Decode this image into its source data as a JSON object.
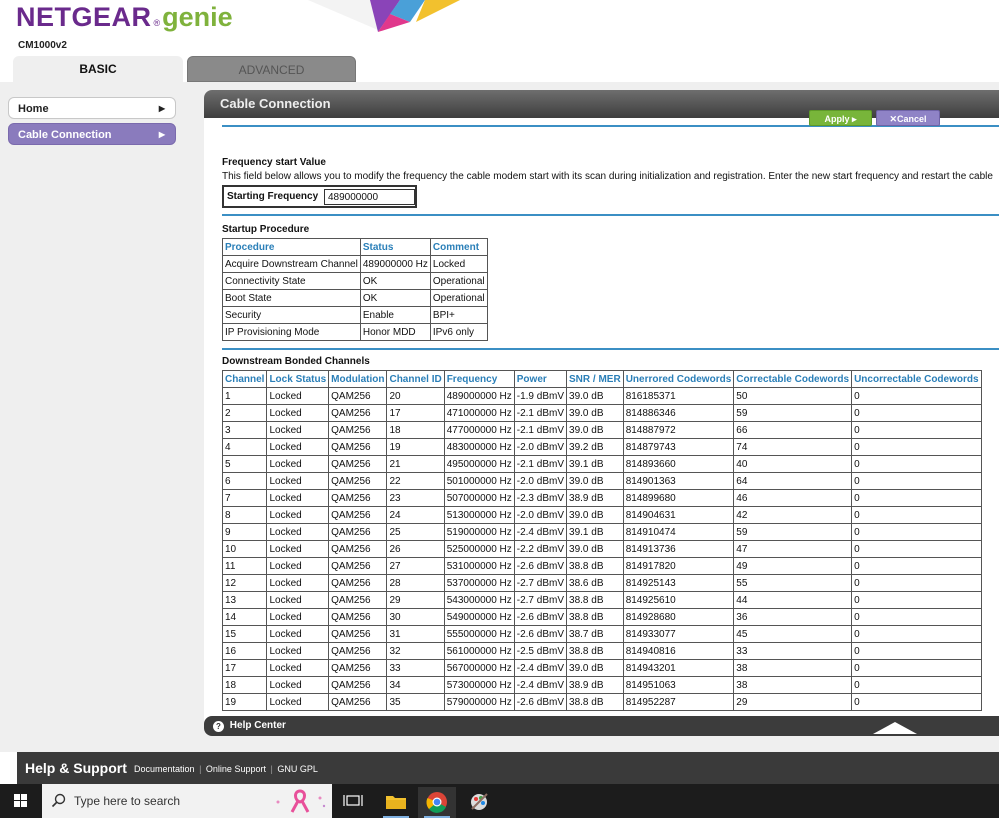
{
  "brand": {
    "name": "NETGEAR",
    "reg": "®",
    "product": "genie",
    "model": "CM1000v2"
  },
  "tabs": {
    "basic": "BASIC",
    "advanced": "ADVANCED"
  },
  "nav": {
    "home": "Home",
    "cable": "Cable Connection"
  },
  "panel_title": "Cable Connection",
  "buttons": {
    "apply": "Apply ▸",
    "cancel": "✕Cancel"
  },
  "freq": {
    "title": "Frequency start Value",
    "desc": "This field below allows you to modify the frequency the cable modem start with its scan during initialization and registration. Enter the new start frequency and restart the cable",
    "label": "Starting Frequency",
    "value": "489000000"
  },
  "startup": {
    "title": "Startup Procedure",
    "headers": [
      "Procedure",
      "Status",
      "Comment"
    ],
    "rows": [
      [
        "Acquire Downstream Channel",
        "489000000 Hz",
        "Locked"
      ],
      [
        "Connectivity State",
        "OK",
        "Operational"
      ],
      [
        "Boot State",
        "OK",
        "Operational"
      ],
      [
        "Security",
        "Enable",
        "BPI+"
      ],
      [
        "IP Provisioning Mode",
        "Honor MDD",
        "IPv6 only"
      ]
    ]
  },
  "downstream": {
    "title": "Downstream Bonded Channels",
    "headers": [
      "Channel",
      "Lock Status",
      "Modulation",
      "Channel ID",
      "Frequency",
      "Power",
      "SNR / MER",
      "Unerrored Codewords",
      "Correctable Codewords",
      "Uncorrectable Codewords"
    ],
    "rows": [
      [
        "1",
        "Locked",
        "QAM256",
        "20",
        "489000000 Hz",
        "-1.9 dBmV",
        "39.0 dB",
        "816185371",
        "50",
        "0"
      ],
      [
        "2",
        "Locked",
        "QAM256",
        "17",
        "471000000 Hz",
        "-2.1 dBmV",
        "39.0 dB",
        "814886346",
        "59",
        "0"
      ],
      [
        "3",
        "Locked",
        "QAM256",
        "18",
        "477000000 Hz",
        "-2.1 dBmV",
        "39.0 dB",
        "814887972",
        "66",
        "0"
      ],
      [
        "4",
        "Locked",
        "QAM256",
        "19",
        "483000000 Hz",
        "-2.0 dBmV",
        "39.2 dB",
        "814879743",
        "74",
        "0"
      ],
      [
        "5",
        "Locked",
        "QAM256",
        "21",
        "495000000 Hz",
        "-2.1 dBmV",
        "39.1 dB",
        "814893660",
        "40",
        "0"
      ],
      [
        "6",
        "Locked",
        "QAM256",
        "22",
        "501000000 Hz",
        "-2.0 dBmV",
        "39.0 dB",
        "814901363",
        "64",
        "0"
      ],
      [
        "7",
        "Locked",
        "QAM256",
        "23",
        "507000000 Hz",
        "-2.3 dBmV",
        "38.9 dB",
        "814899680",
        "46",
        "0"
      ],
      [
        "8",
        "Locked",
        "QAM256",
        "24",
        "513000000 Hz",
        "-2.0 dBmV",
        "39.0 dB",
        "814904631",
        "42",
        "0"
      ],
      [
        "9",
        "Locked",
        "QAM256",
        "25",
        "519000000 Hz",
        "-2.4 dBmV",
        "39.1 dB",
        "814910474",
        "59",
        "0"
      ],
      [
        "10",
        "Locked",
        "QAM256",
        "26",
        "525000000 Hz",
        "-2.2 dBmV",
        "39.0 dB",
        "814913736",
        "47",
        "0"
      ],
      [
        "11",
        "Locked",
        "QAM256",
        "27",
        "531000000 Hz",
        "-2.6 dBmV",
        "38.8 dB",
        "814917820",
        "49",
        "0"
      ],
      [
        "12",
        "Locked",
        "QAM256",
        "28",
        "537000000 Hz",
        "-2.7 dBmV",
        "38.6 dB",
        "814925143",
        "55",
        "0"
      ],
      [
        "13",
        "Locked",
        "QAM256",
        "29",
        "543000000 Hz",
        "-2.7 dBmV",
        "38.8 dB",
        "814925610",
        "44",
        "0"
      ],
      [
        "14",
        "Locked",
        "QAM256",
        "30",
        "549000000 Hz",
        "-2.6 dBmV",
        "38.8 dB",
        "814928680",
        "36",
        "0"
      ],
      [
        "15",
        "Locked",
        "QAM256",
        "31",
        "555000000 Hz",
        "-2.6 dBmV",
        "38.7 dB",
        "814933077",
        "45",
        "0"
      ],
      [
        "16",
        "Locked",
        "QAM256",
        "32",
        "561000000 Hz",
        "-2.5 dBmV",
        "38.8 dB",
        "814940816",
        "33",
        "0"
      ],
      [
        "17",
        "Locked",
        "QAM256",
        "33",
        "567000000 Hz",
        "-2.4 dBmV",
        "39.0 dB",
        "814943201",
        "38",
        "0"
      ],
      [
        "18",
        "Locked",
        "QAM256",
        "34",
        "573000000 Hz",
        "-2.4 dBmV",
        "38.9 dB",
        "814951063",
        "38",
        "0"
      ],
      [
        "19",
        "Locked",
        "QAM256",
        "35",
        "579000000 Hz",
        "-2.6 dBmV",
        "38.8 dB",
        "814952287",
        "29",
        "0"
      ]
    ]
  },
  "help_center": "Help Center",
  "support": {
    "title": "Help & Support",
    "links": [
      "Documentation",
      "Online Support",
      "GNU GPL"
    ]
  },
  "taskbar": {
    "search_placeholder": "Type here to search"
  },
  "colors": {
    "brand_purple": "#6a2a8c",
    "genie_green": "#7fb23c",
    "link_blue": "#2a7fb8",
    "apply_green": "#78b53a",
    "cancel_purple": "#8f83c6"
  }
}
